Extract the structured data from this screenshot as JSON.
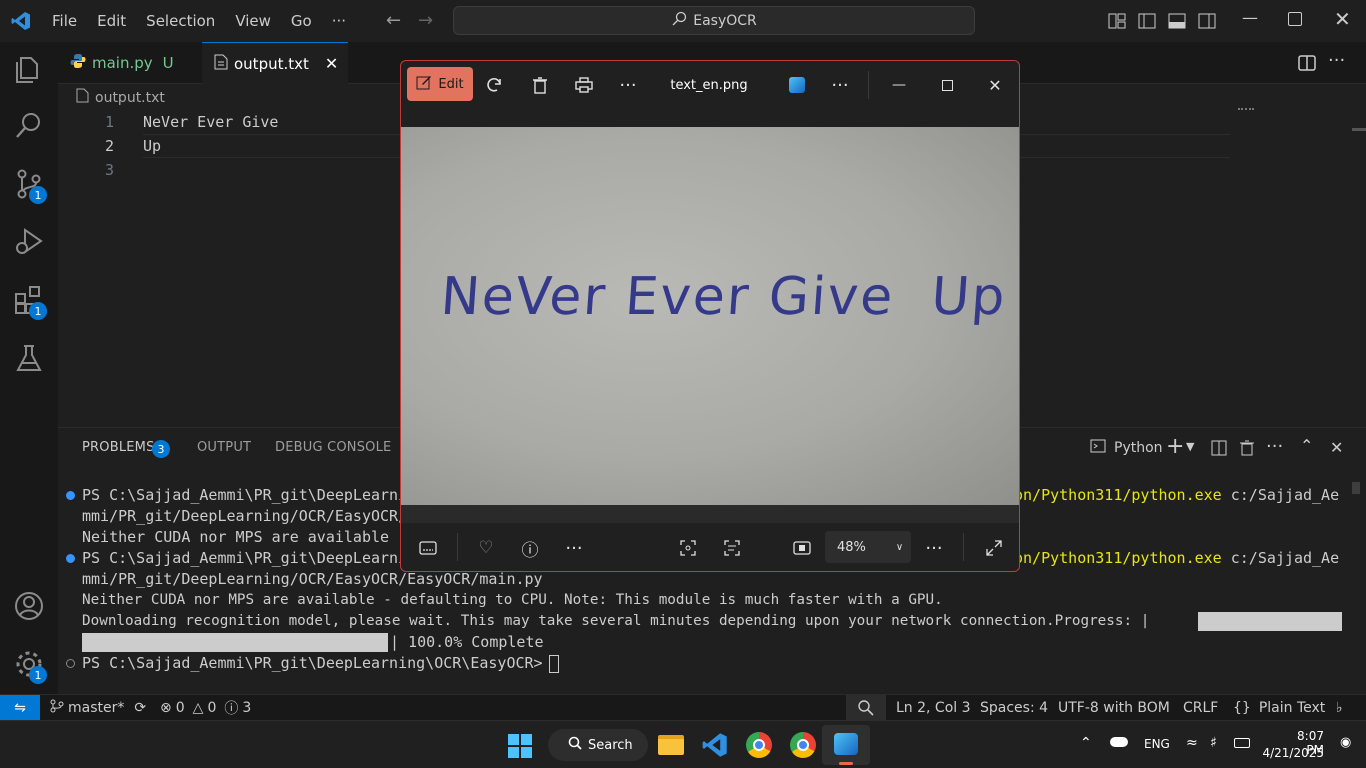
{
  "titlebar": {
    "menu": [
      "File",
      "Edit",
      "Selection",
      "View",
      "Go"
    ],
    "more": "···",
    "search_text": "EasyOCR"
  },
  "activity": {
    "scm_badge": "1",
    "extensions_badge": "1",
    "settings_badge": "1"
  },
  "tabs": [
    {
      "label": "main.py",
      "status": "U",
      "active": false
    },
    {
      "label": "output.txt",
      "active": true
    }
  ],
  "editor": {
    "breadcrumb": "output.txt",
    "lines": [
      {
        "num": "1",
        "text": "NeVer Ever Give"
      },
      {
        "num": "2",
        "text": "Up"
      },
      {
        "num": "3",
        "text": ""
      }
    ]
  },
  "panel": {
    "tabs": [
      "PROBLEMS",
      "OUTPUT",
      "DEBUG CONSOLE"
    ],
    "problems_count": "3",
    "terminal_name": "Python",
    "terminal": {
      "l1a": "PS C:\\Sajjad_Aemmi\\PR_git\\DeepLearni",
      "l1b": "on/Python311/python.exe",
      "l1c": " c:/Sajjad_Ae",
      "l2": "mmi/PR_git/DeepLearning/OCR/EasyOCR/",
      "l3": "Neither CUDA nor MPS are available -",
      "l4a": "PS C:\\Sajjad_Aemmi\\PR_git\\DeepLearni",
      "l4b": "on/Python311/python.exe",
      "l4c": " c:/Sajjad_Ae",
      "l5": "mmi/PR_git/DeepLearning/OCR/EasyOCR/EasyOCR/main.py",
      "l6": "Neither CUDA nor MPS are available - defaulting to CPU. Note: This module is much faster with a GPU.",
      "l7": "Downloading recognition model, please wait. This may take several minutes depending upon your network connection.Progress: |",
      "l8": "| 100.0% Complete",
      "l9": "PS C:\\Sajjad_Aemmi\\PR_git\\DeepLearning\\OCR\\EasyOCR> "
    }
  },
  "statusbar": {
    "branch": "master*",
    "errors": "0",
    "warnings": "0",
    "info": "3",
    "position": "Ln 2, Col 3",
    "spaces": "Spaces: 4",
    "encoding": "UTF-8 with BOM",
    "eol": "CRLF",
    "language": "Plain Text"
  },
  "photos": {
    "edit_label": "Edit",
    "filename": "text_en.png",
    "handwriting": "NeVer Ever Give  Up",
    "zoom": "48%"
  },
  "taskbar": {
    "search_label": "Search",
    "lang": "ENG",
    "time": "8:07 PM",
    "date": "4/21/2025"
  },
  "colors": {
    "accent": "#0078d4",
    "photos_edit": "#e2735e",
    "photos_border": "#c23b3b",
    "terminal_yellow": "#e5e510"
  }
}
